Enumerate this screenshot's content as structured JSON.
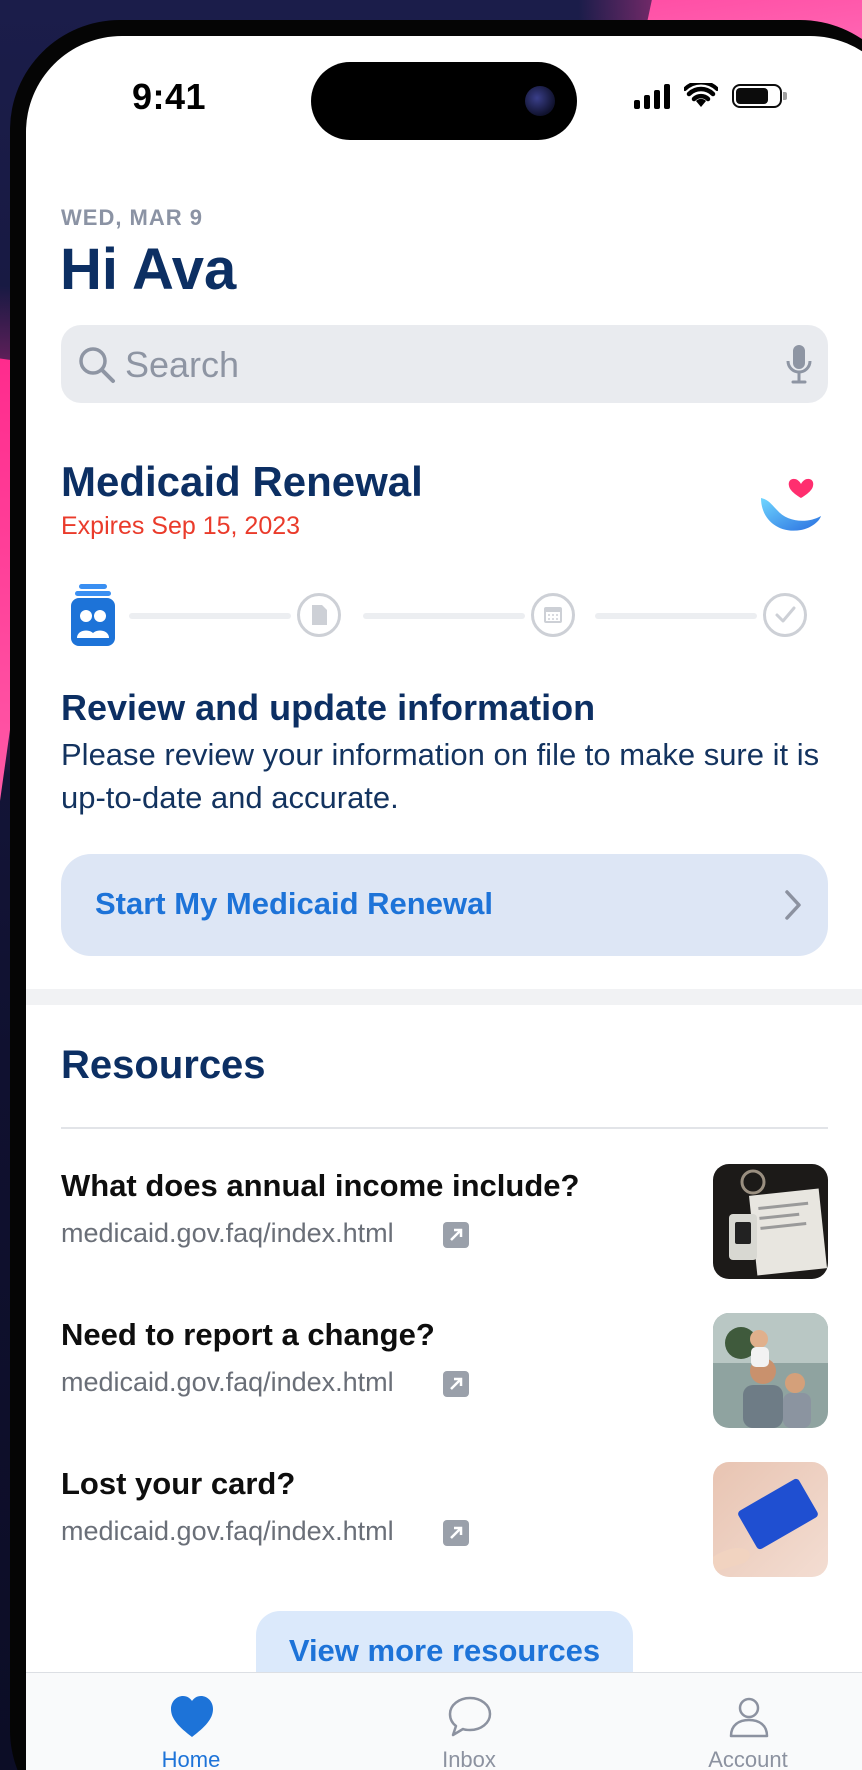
{
  "status_bar": {
    "time": "9:41"
  },
  "header": {
    "date": "WED, MAR 9",
    "greeting": "Hi Ava"
  },
  "search": {
    "placeholder": "Search"
  },
  "renewal": {
    "title": "Medicaid Renewal",
    "expiry": "Expires Sep 15, 2023",
    "progress": {
      "total_steps": 4,
      "current_step": 1
    },
    "step_title": "Review and update information",
    "step_description": "Please review your information on file to make sure it is up-to-date and accurate.",
    "cta_label": "Start My Medicaid Renewal"
  },
  "resources": {
    "title": "Resources",
    "items": [
      {
        "title": "What does annual income include?",
        "link": "medicaid.gov.faq/index.html",
        "thumbnail": "documents-photo"
      },
      {
        "title": "Need to report a change?",
        "link": "medicaid.gov.faq/index.html",
        "thumbnail": "family-photo"
      },
      {
        "title": "Lost your card?",
        "link": "medicaid.gov.faq/index.html",
        "thumbnail": "blue-card-photo"
      }
    ],
    "more_label": "View more resources"
  },
  "tab_bar": {
    "tabs": [
      {
        "label": "Home",
        "icon": "heart-icon",
        "active": true
      },
      {
        "label": "Inbox",
        "icon": "chat-bubble-icon",
        "active": false
      },
      {
        "label": "Account",
        "icon": "person-icon",
        "active": false
      }
    ]
  },
  "colors": {
    "primary_text": "#0c2f63",
    "accent_blue": "#1d73d8",
    "alert_red": "#ea3b2b",
    "cta_background": "#dde6f5"
  }
}
